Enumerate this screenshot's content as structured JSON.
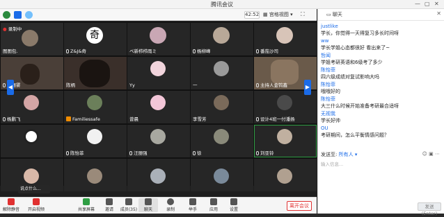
{
  "titlebar": {
    "title": "腾讯会议",
    "min": "—",
    "max": "▢",
    "close": "✕"
  },
  "toolbar": {
    "timer": "42:52",
    "view_label": "宫格视图",
    "view_caret": "▾",
    "full": "⛶"
  },
  "grid": {
    "row1": [
      "录制中",
      "",
      "",
      "",
      ""
    ],
    "names": [
      [
        "图图包.",
        "Z&J&奇",
        "ベ新栉栉雨ミ",
        "杨柳峰",
        "番茄沙司"
      ],
      [
        "张丽雾",
        "陈柄",
        "Yy",
        "一",
        "主持人金钨鑫"
      ],
      [
        "杨鹏飞",
        "Familiessafe",
        "曾晨",
        "李雪芳",
        "设计4班一付潘扬"
      ],
      [
        "",
        "陈怡菲",
        "汪丽强",
        "徐",
        "刘亚铃"
      ],
      [
        "",
        "",
        "",
        "",
        ""
      ]
    ],
    "avatar_char": "奇",
    "tooltip": "说点什么...",
    "bottom_left_name": ""
  },
  "bottombar": {
    "items": [
      "解除静音",
      "开启视频",
      "共享屏幕",
      "邀请",
      "成员(35)",
      "聊天",
      "录制",
      "举手",
      "应用",
      "设置"
    ],
    "leave": "离开会议"
  },
  "chat": {
    "header": "聊天",
    "messages": [
      {
        "sender": "justlike",
        "text": "学长，你觉得一天得复习多长时间呀"
      },
      {
        "sender": "ww",
        "text": "学长学姐心态都很好 看出来了~"
      },
      {
        "sender": "哲闻",
        "text": "学姐考研英语和6级考了多少"
      },
      {
        "sender": "陈怡菲",
        "text": "四六级成绩对复试影响大吗"
      },
      {
        "sender": "陈怡菲",
        "text": "哦哦好的"
      },
      {
        "sender": "陈怡菲",
        "text": "大三什么时候开始准备考研最合适呀"
      },
      {
        "sender": "无视我",
        "text": "学长好帅"
      },
      {
        "sender": "OU",
        "text": "考研期间，怎么平衡情感问题？"
      }
    ],
    "send_to_label": "发送至:",
    "send_to_value": "所有人 ▾",
    "input_placeholder": "输入信息...",
    "send_button": "发送(Enter)"
  },
  "colors": {
    "accent": "#1a6be8",
    "leave": "#e03131",
    "speaking": "#2f9e44"
  }
}
